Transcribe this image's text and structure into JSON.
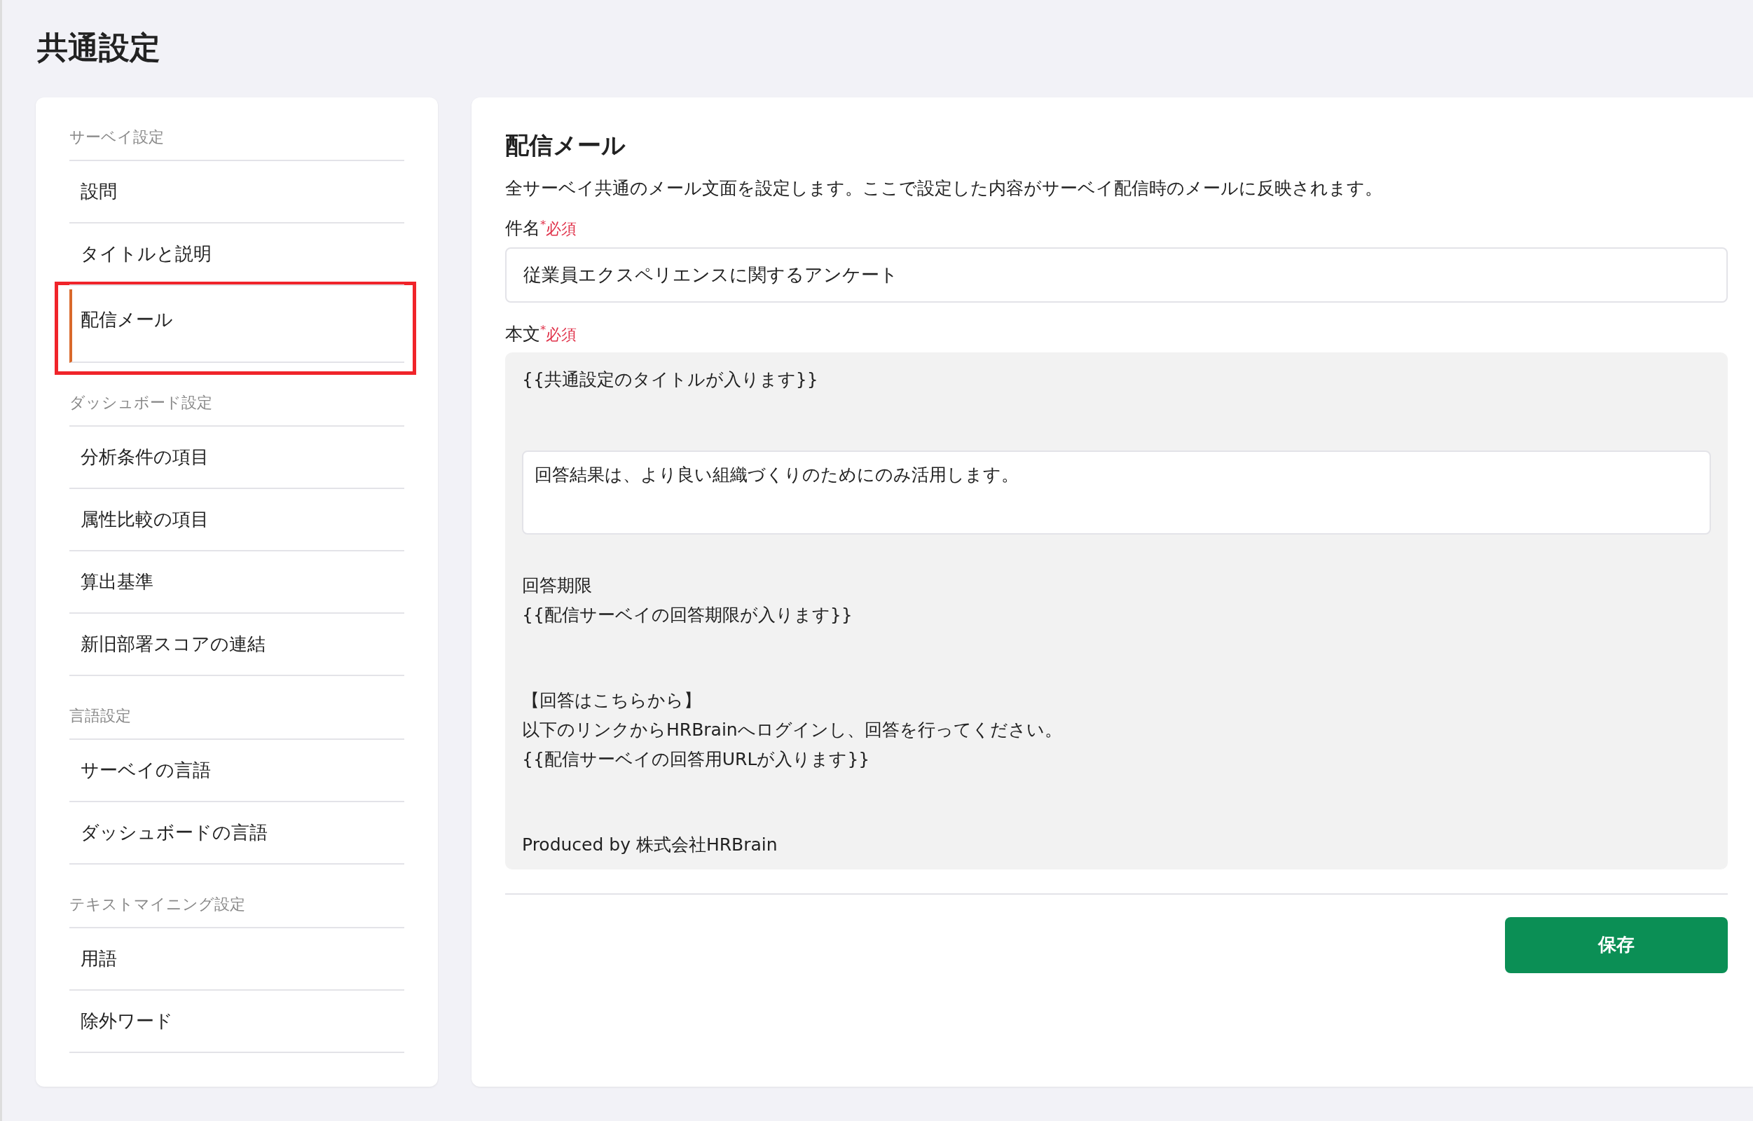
{
  "page_title": "共通設定",
  "sidebar": {
    "sections": [
      {
        "title": "サーベイ設定",
        "items": [
          {
            "label": "設問",
            "selected": false,
            "highlighted": false
          },
          {
            "label": "タイトルと説明",
            "selected": false,
            "highlighted": false
          },
          {
            "label": "配信メール",
            "selected": true,
            "highlighted": true
          }
        ]
      },
      {
        "title": "ダッシュボード設定",
        "items": [
          {
            "label": "分析条件の項目",
            "selected": false,
            "highlighted": false
          },
          {
            "label": "属性比較の項目",
            "selected": false,
            "highlighted": false
          },
          {
            "label": "算出基準",
            "selected": false,
            "highlighted": false
          },
          {
            "label": "新旧部署スコアの連結",
            "selected": false,
            "highlighted": false
          }
        ]
      },
      {
        "title": "言語設定",
        "items": [
          {
            "label": "サーベイの言語",
            "selected": false,
            "highlighted": false
          },
          {
            "label": "ダッシュボードの言語",
            "selected": false,
            "highlighted": false
          }
        ]
      },
      {
        "title": "テキストマイニング設定",
        "items": [
          {
            "label": "用語",
            "selected": false,
            "highlighted": false
          },
          {
            "label": "除外ワード",
            "selected": false,
            "highlighted": false
          }
        ]
      }
    ]
  },
  "panel": {
    "title": "配信メール",
    "description": "全サーベイ共通のメール文面を設定します。ここで設定した内容がサーベイ配信時のメールに反映されます。",
    "subject": {
      "label": "件名",
      "required_mark": "*",
      "required": "必須",
      "value": "従業員エクスペリエンスに関するアンケート"
    },
    "body": {
      "label": "本文",
      "required_mark": "*",
      "required": "必須",
      "blocks": [
        {
          "kind": "text",
          "lines": [
            "{{共通設定のタイトルが入ります}}"
          ]
        },
        {
          "kind": "textarea",
          "value": "回答結果は、より良い組織づくりのためにのみ活用します。"
        },
        {
          "kind": "text",
          "lines": [
            "回答期限",
            "{{配信サーベイの回答期限が入ります}}"
          ]
        },
        {
          "kind": "text",
          "lines": [
            "【回答はこちらから】",
            "以下のリンクからHRBrainへログインし、回答を行ってください。",
            "{{配信サーベイの回答用URLが入ります}}"
          ]
        },
        {
          "kind": "text",
          "lines": [
            "Produced by 株式会社HRBrain"
          ]
        }
      ]
    },
    "save_button": "保存"
  }
}
